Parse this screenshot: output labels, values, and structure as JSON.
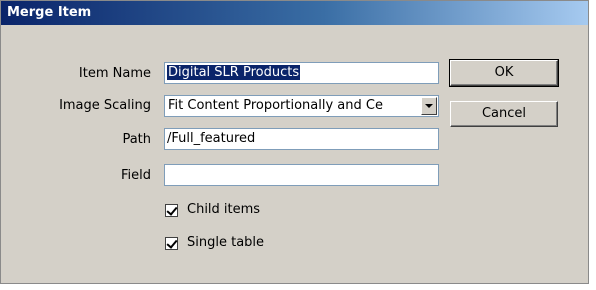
{
  "dialog": {
    "title": "Merge Item"
  },
  "fields": {
    "item_name_label": "Item Name",
    "item_name_value": "Digital SLR Products",
    "image_scaling_label": "Image Scaling",
    "image_scaling_value": "Fit Content Proportionally and Ce",
    "path_label": "Path",
    "path_value": "/Full_featured",
    "field_label": "Field",
    "field_value": ""
  },
  "options": {
    "child_items_label": "Child items",
    "child_items_checked": true,
    "single_table_label": "Single table",
    "single_table_checked": true
  },
  "buttons": {
    "ok_label": "OK",
    "cancel_label": "Cancel"
  }
}
